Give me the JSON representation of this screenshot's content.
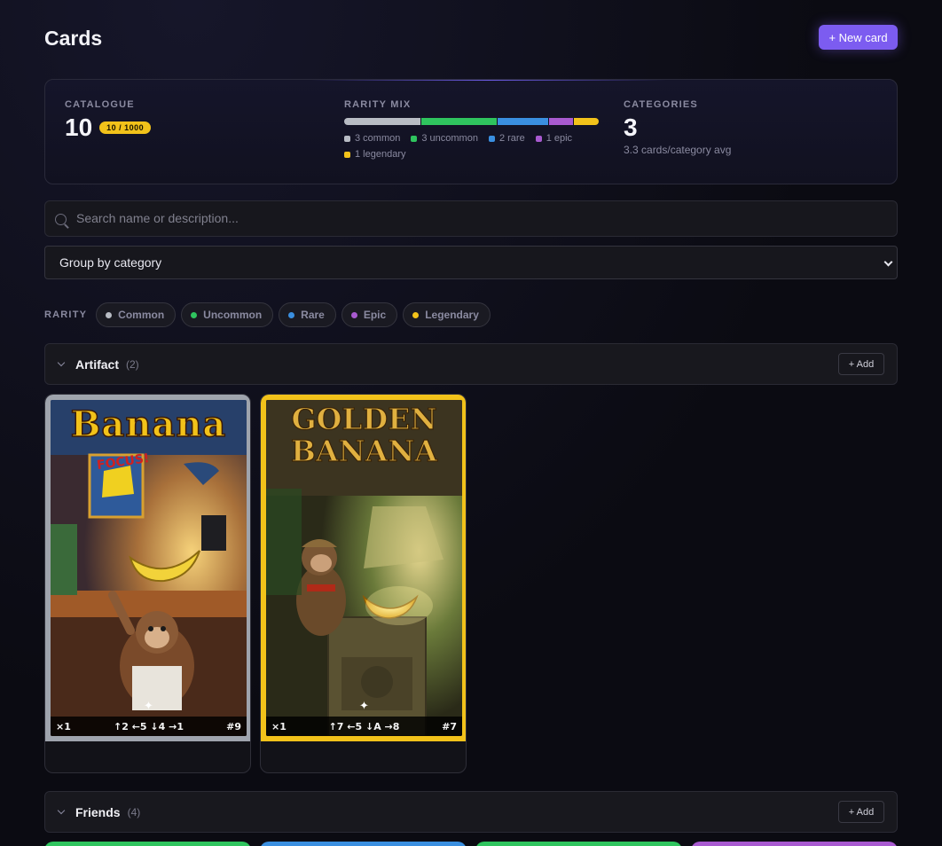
{
  "header": {
    "title": "Cards",
    "new_card_label": "+ New card"
  },
  "stats": {
    "catalogue_label": "CATALOGUE",
    "catalogue_count": "10",
    "catalogue_badge": "10 / 1000",
    "rarity_mix_label": "RARITY MIX",
    "rarity_mix": [
      {
        "label": "3 common",
        "count": 3,
        "color": "#b8bcc4"
      },
      {
        "label": "3 uncommon",
        "count": 3,
        "color": "#2fc45e"
      },
      {
        "label": "2 rare",
        "count": 2,
        "color": "#3a8fe0"
      },
      {
        "label": "1 epic",
        "count": 1,
        "color": "#a85ad0"
      },
      {
        "label": "1 legendary",
        "count": 1,
        "color": "#f2c21a"
      }
    ],
    "categories_label": "CATEGORIES",
    "categories_count": "3",
    "categories_sub": "3.3 cards/category avg"
  },
  "search": {
    "placeholder": "Search name or description..."
  },
  "group_by": {
    "selected": "Group by category"
  },
  "rarity_filter": {
    "label": "RARITY",
    "chips": [
      {
        "label": "Common",
        "color": "#b8bcc4"
      },
      {
        "label": "Uncommon",
        "color": "#2fc45e"
      },
      {
        "label": "Rare",
        "color": "#3a8fe0"
      },
      {
        "label": "Epic",
        "color": "#a85ad0"
      },
      {
        "label": "Legendary",
        "color": "#f2c21a"
      }
    ]
  },
  "sections": [
    {
      "title": "Artifact",
      "count": "(2)",
      "add_label": "+ Add",
      "cards": [
        {
          "art_title": "Banana",
          "art_caption": "FOCUS!",
          "qty": "×1",
          "stats": "↑2 ←5 ↓4 →1",
          "number": "#9",
          "sparkle": "✦",
          "border": "#9fa4ad"
        },
        {
          "art_title": "GOLDEN BANANA",
          "qty": "×1",
          "stats": "↑7 ←5 ↓A →8",
          "number": "#7",
          "sparkle": "✦",
          "border": "#f2c21a"
        }
      ]
    },
    {
      "title": "Friends",
      "count": "(4)",
      "add_label": "+ Add",
      "peek_colors": [
        "#2fc45e",
        "#3a8fe0",
        "#2fc45e",
        "#a85ad0"
      ]
    }
  ]
}
